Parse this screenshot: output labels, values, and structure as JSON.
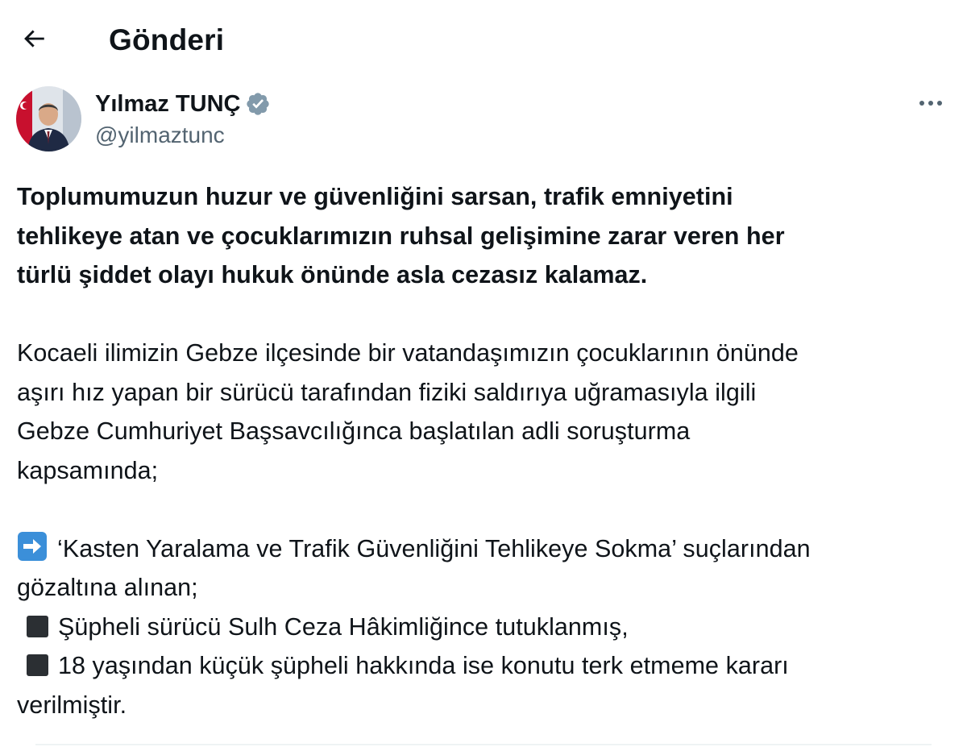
{
  "header": {
    "back_icon": "arrow-left-icon",
    "title": "Gönderi"
  },
  "author": {
    "display_name": "Yılmaz TUNÇ",
    "handle": "@yilmaztunc",
    "verified_icon": "verified-badge-icon",
    "verified_color": "#829aab",
    "more_icon": "more-horizontal-icon"
  },
  "tweet": {
    "lead_lines": [
      "Toplumumuzun huzur ve güvenliğini sarsan, trafik emniyetini",
      "tehlikeye atan ve çocuklarımızın ruhsal gelişimine zarar veren her",
      "türlü şiddet olayı hukuk önünde asla cezasız kalamaz."
    ],
    "para2_lines": [
      "Kocaeli ilimizin Gebze ilçesinde bir vatandaşımızın çocuklarının önünde",
      "aşırı hız yapan bir sürücü tarafından fiziki saldırıya uğramasıyla ilgili",
      "Gebze Cumhuriyet Başsavcılığınca başlatılan adli soruşturma",
      "kapsamında;"
    ],
    "arrow_icon": "right-arrow-emoji-icon",
    "arrow_line1": "‘Kasten Yaralama ve Trafik Güvenliğini Tehlikeye Sokma’ suçlarından",
    "arrow_line2": "gözaltına alınan;",
    "bullet_icon": "black-square-icon",
    "bullet1": "Şüpheli sürücü Sulh Ceza Hâkimliğince tutuklanmış,",
    "bullet2_line1": "18 yaşından küçük şüpheli hakkında ise konutu terk etmeme kararı",
    "bullet2_line2": "verilmiştir."
  },
  "colors": {
    "text_primary": "#0f1419",
    "text_secondary": "#536471",
    "emoji_blue": "#3b8fd9",
    "divider": "#eff3f4"
  }
}
